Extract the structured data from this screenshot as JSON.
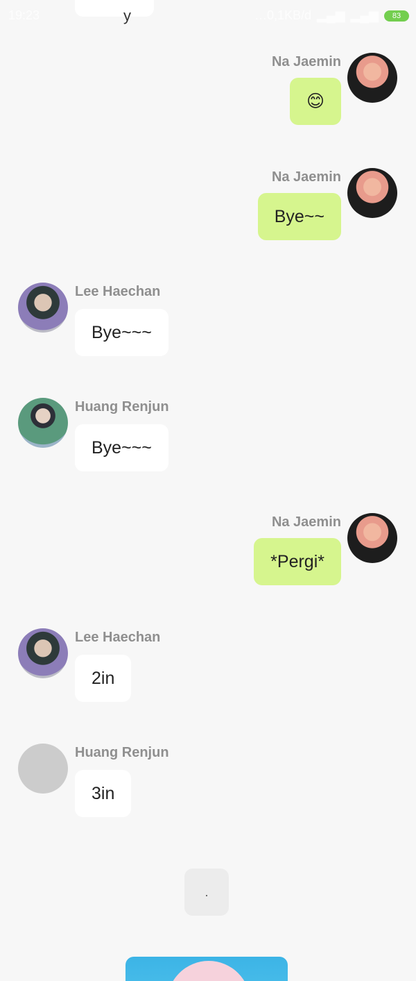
{
  "status_bar": {
    "time": "19:23",
    "network_speed": "…0,1KB/d",
    "battery": "83"
  },
  "top_bubble": {
    "text": "y"
  },
  "messages": [
    {
      "side": "right",
      "sender": "Na Jaemin",
      "text": "😊",
      "avatar": "jaemin-avatar"
    },
    {
      "side": "right",
      "sender": "Na Jaemin",
      "text": "Bye~~",
      "avatar": "jaemin-avatar"
    },
    {
      "side": "left",
      "sender": "Lee Haechan",
      "text": "Bye~~~",
      "avatar": "haechan-avatar"
    },
    {
      "side": "left",
      "sender": "Huang Renjun",
      "text": "Bye~~~",
      "avatar": "renjun-avatar"
    },
    {
      "side": "right",
      "sender": "Na Jaemin",
      "text": "*Pergi*",
      "avatar": "jaemin-avatar"
    },
    {
      "side": "left",
      "sender": "Lee Haechan",
      "text": "2in",
      "avatar": "haechan-avatar"
    },
    {
      "side": "left",
      "sender": "Huang Renjun",
      "text": "3in",
      "avatar": "empty-avatar"
    }
  ],
  "dot_card": {
    "text": "."
  },
  "colors": {
    "background": "#f7f7f7",
    "outgoing_bubble": "#d6f58e",
    "incoming_bubble": "#ffffff",
    "sender_name": "#8f8f8f",
    "battery": "#5cc832"
  }
}
